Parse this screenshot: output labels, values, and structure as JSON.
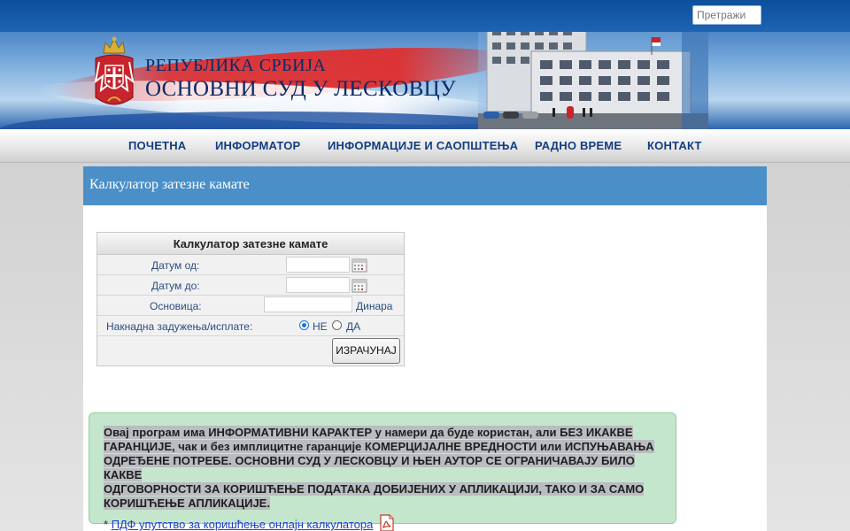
{
  "header": {
    "search_placeholder": "Претражи",
    "title_line1": "РЕПУБЛИКА СРБИЈА",
    "title_line2": "ОСНОВНИ СУД У ЛЕСКОВЦУ"
  },
  "nav": {
    "items": [
      "ПОЧЕТНА",
      "ИНФОРМАТОР",
      "ИНФОРМАЦИЈЕ И САОПШТЕЊА",
      "РАДНО ВРЕМЕ",
      "КОНТАКТ"
    ]
  },
  "page": {
    "title": "Калкулатор затезне камате"
  },
  "calculator": {
    "title": "Калкулатор затезне камате",
    "date_from_label": "Датум од:",
    "date_from_value": "",
    "date_to_label": "Датум до:",
    "date_to_value": "",
    "principal_label": "Основица:",
    "principal_value": "",
    "currency": "Динара",
    "extra_label": "Накнадна задужења/исплате:",
    "option_no": "НЕ",
    "option_yes": "ДА",
    "selected_option": "НЕ",
    "submit_label": "ИЗРАЧУНАЈ"
  },
  "notice": {
    "lines": [
      "Овај програм има ИНФОРМАТИВНИ КАРАКТЕР у намери да буде користан, али БЕЗ ИКАКВЕ",
      "ГАРАНЦИЈЕ, чак и без имплицитне гаранције КОМЕРЦИЈАЛНЕ ВРЕДНОСТИ или ИСПУЊАВАЊА",
      "ОДРЕЂЕНЕ ПОТРЕБЕ. ОСНОВНИ СУД У ЛЕСКОВЦУ И ЊЕН АУТОР СЕ ОГРАНИЧАВАЈУ БИЛО КАКВЕ",
      "ОДГОВОРНОСТИ ЗА КОРИШЋЕЊЕ ПОДАТАКА ДОБИЈЕНИХ У АПЛИКАЦИЈИ, ТАКО И ЗА САМО",
      "КОРИШЋЕЊЕ АПЛИКАЦИЈЕ."
    ],
    "link_prefix": "*",
    "link_text": "ПДФ упутство за коришћење онлајн калкулатора"
  },
  "colors": {
    "nav_text": "#123d82",
    "page_header_bg": "#4a8fc8",
    "notice_bg": "#c4e6cc",
    "link": "#1a3fc4"
  }
}
